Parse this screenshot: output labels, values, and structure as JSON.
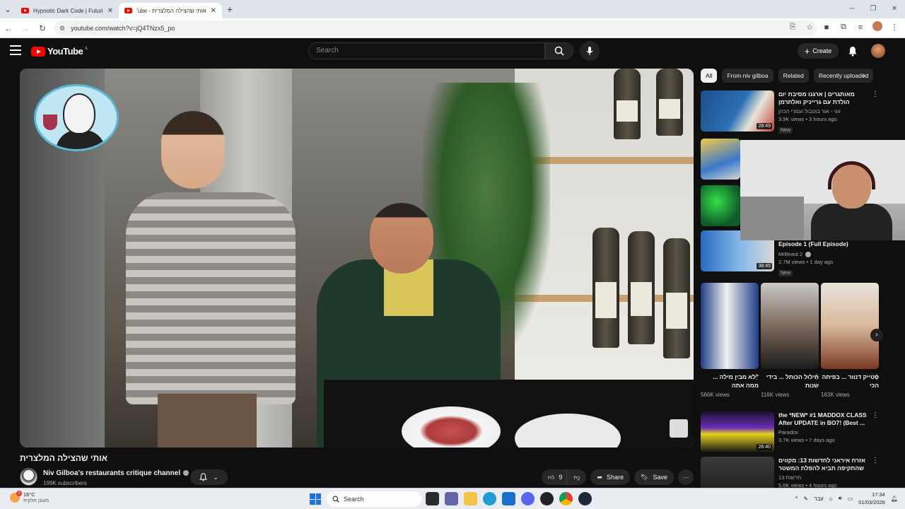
{
  "browser": {
    "tabs": [
      {
        "title": "Hypnotic Dark Code | Futuristic",
        "active": false
      },
      {
        "title": "אותי שהצילה המלצרית - YouTube",
        "active": true
      }
    ],
    "url": "youtube.com/watch?v=jQ4TNzx5_po"
  },
  "header": {
    "logo_text": "YouTube",
    "logo_country": "IL",
    "search_placeholder": "Search",
    "create_label": "Create"
  },
  "video": {
    "title": "אותי שהצילה המלצרית",
    "channel_name": "Niv Gilboa's restaurants critique channel",
    "subscribers": "199K subscribers",
    "likes": "9",
    "share_label": "Share",
    "save_label": "Save"
  },
  "chips": [
    "All",
    "From niv gilboa",
    "Related",
    "Recently uploaded"
  ],
  "recommendations": [
    {
      "title": "מאותגרים | ארגנו מסיבת יום הולדת עם גרייניק ואלתרמן",
      "channel": "זוגי - אור בוטבול ועמרי הכהן",
      "meta": "3.9K views • 3 hours ago",
      "badge": "New",
      "duration": "28:49"
    },
    {
      "title": "Episode 1 (Full Episode)",
      "channel": "MrBeast 2",
      "meta": "2.7M views • 1 day ago",
      "badge": "New",
      "duration": "38:45"
    },
    {
      "title": "the *NEW* #1 MADDOX CLASS After UPDATE in BO7! (Best ...",
      "channel": "Paradox",
      "meta": "3.7K views • 7 days ago",
      "duration": "26:40"
    },
    {
      "title": "אזרח איראני לחדשות 13: מקווים שהתקיפה תביא להפלת המשטר",
      "channel": "חדשות 13",
      "meta": "5.6K views • 4 hours ago"
    }
  ],
  "shorts": [
    {
      "title": "\"לא מבין מילה ... ממה אתה",
      "views": "566K views"
    },
    {
      "title": "חילול הכותל ... בידי שנות",
      "views": "116K views"
    },
    {
      "title": "סטייק דנוור ... בפיתה הכי",
      "views": "163K views"
    }
  ],
  "taskbar": {
    "weather_temp": "16°C",
    "weather_desc": "מעונן חלקית",
    "weather_badge": "3",
    "search_label": "Search",
    "lang": "עבר",
    "time": "17:34",
    "date": "01/03/2026"
  },
  "colors": {
    "yt_red": "#ff0000",
    "page_bg": "#0f0f0f",
    "chip_bg": "#272727"
  }
}
